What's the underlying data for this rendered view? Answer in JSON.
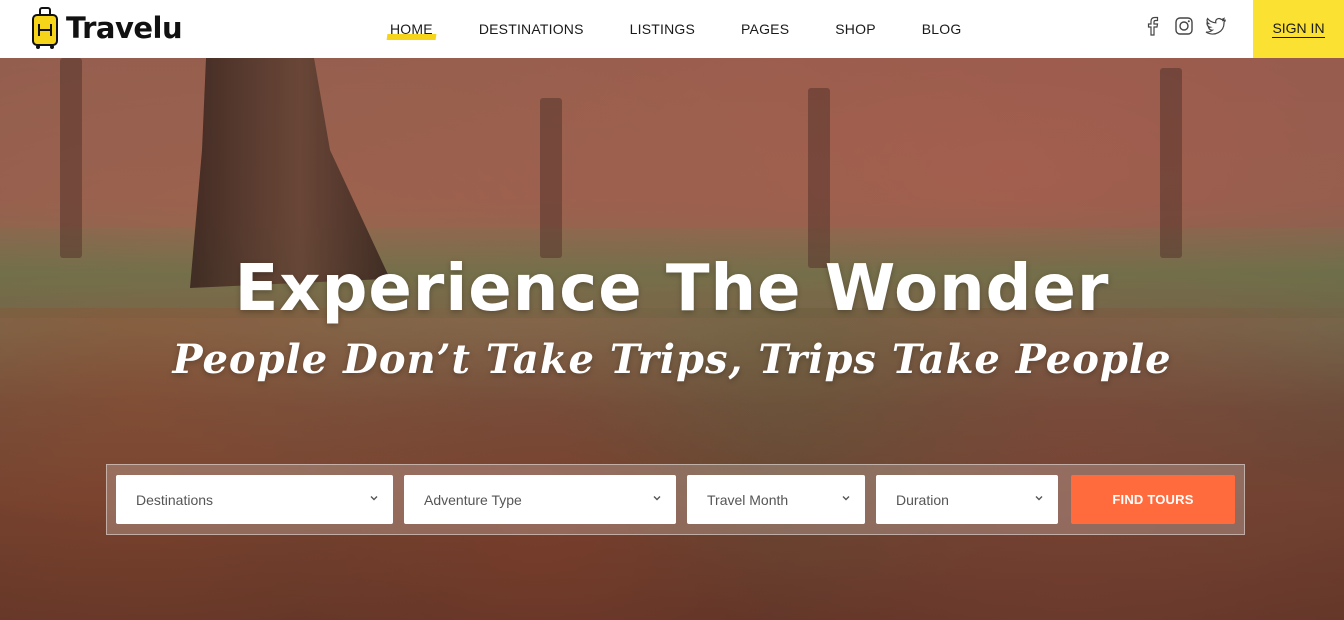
{
  "brand": {
    "name": "Travelu",
    "accent": "#f6d41a"
  },
  "nav": {
    "items": [
      {
        "label": "HOME",
        "active": true
      },
      {
        "label": "DESTINATIONS"
      },
      {
        "label": "LISTINGS"
      },
      {
        "label": "PAGES"
      },
      {
        "label": "SHOP"
      },
      {
        "label": "BLOG"
      }
    ]
  },
  "social": [
    "facebook-icon",
    "instagram-icon",
    "twitter-icon"
  ],
  "signin": {
    "label": "SIGN IN",
    "bg": "#fbe232"
  },
  "hero": {
    "title": "Experience The Wonder",
    "tagline": "People Don’t Take Trips, Trips Take People"
  },
  "search": {
    "fields": [
      {
        "label": "Destinations"
      },
      {
        "label": "Adventure Type"
      },
      {
        "label": "Travel Month"
      },
      {
        "label": "Duration"
      }
    ],
    "button": {
      "label": "FIND TOURS",
      "color": "#ff6b3d"
    }
  }
}
